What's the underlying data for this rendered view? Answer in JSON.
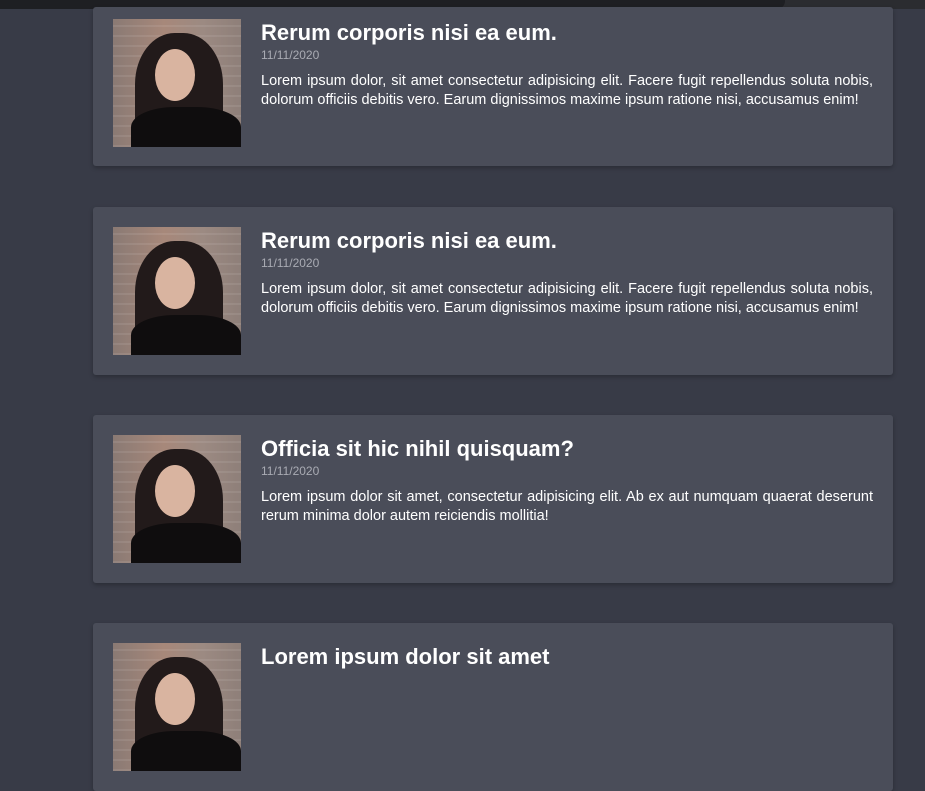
{
  "posts": [
    {
      "title": "Rerum corporis nisi ea eum.",
      "date": "11/11/2020",
      "body": "Lorem ipsum dolor, sit amet consectetur adipisicing elit. Facere fugit repellendus soluta nobis, dolorum officiis debitis vero. Earum dignissimos maxime ipsum ratione nisi, accusamus enim!"
    },
    {
      "title": "Rerum corporis nisi ea eum.",
      "date": "11/11/2020",
      "body": "Lorem ipsum dolor, sit amet consectetur adipisicing elit. Facere fugit repellendus soluta nobis, dolorum officiis debitis vero. Earum dignissimos maxime ipsum ratione nisi, accusamus enim!"
    },
    {
      "title": "Officia sit hic nihil quisquam?",
      "date": "11/11/2020",
      "body": "Lorem ipsum dolor sit amet, consectetur adipisicing elit. Ab ex aut numquam quaerat deserunt rerum minima dolor autem reiciendis mollitia!"
    },
    {
      "title": "Lorem ipsum dolor sit amet"
    }
  ]
}
